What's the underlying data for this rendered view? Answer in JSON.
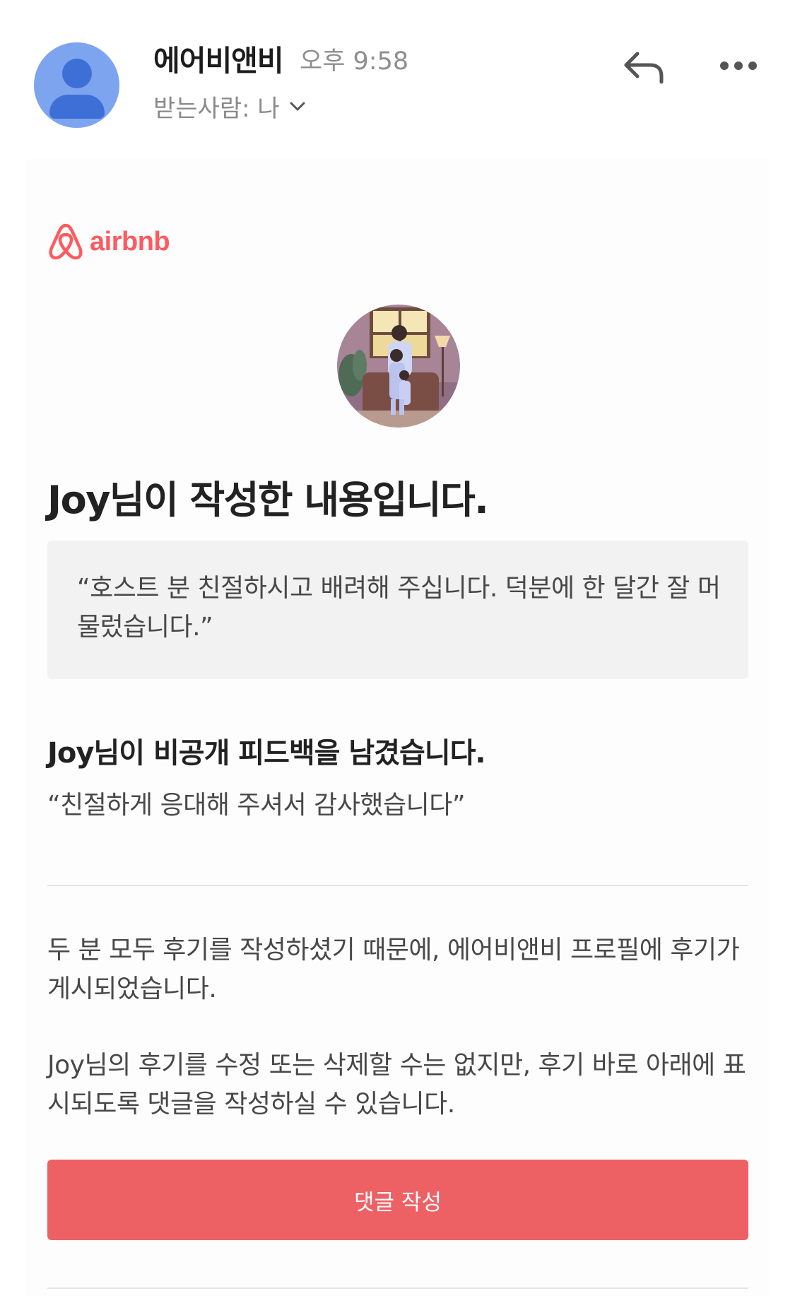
{
  "header": {
    "sender_name": "에어비앤비",
    "sent_time": "오후 9:58",
    "recipient_label": "받는사람: 나",
    "icons": {
      "avatar": "person-icon",
      "reply": "reply-icon",
      "more": "more-icon",
      "expand": "chevron-down-icon"
    }
  },
  "email": {
    "brand_name": "airbnb",
    "brand_color": "#ff5a5f",
    "review_title": "Joy님이 작성한 내용입니다.",
    "review_quote": "“호스트 분 친절하시고 배려해 주십니다. 덕분에 한 달간 잘 머물렀습니다.”",
    "private_feedback_title": "Joy님이 비공개 피드백을 남겼습니다.",
    "private_feedback_text": "“친절하게 응대해 주셔서 감사했습니다”",
    "paragraph_published": "두 분 모두 후기를 작성하셨기 때문에, 에어비앤비 프로필에 후기가 게시되었습니다.",
    "paragraph_comment": "Joy님의 후기를 수정 또는 삭제할 수는 없지만, 후기 바로 아래에 표시되도록 댓글을 작성하실 수 있습니다.",
    "comment_button_label": "댓글 작성",
    "button_color": "#ed6165"
  }
}
